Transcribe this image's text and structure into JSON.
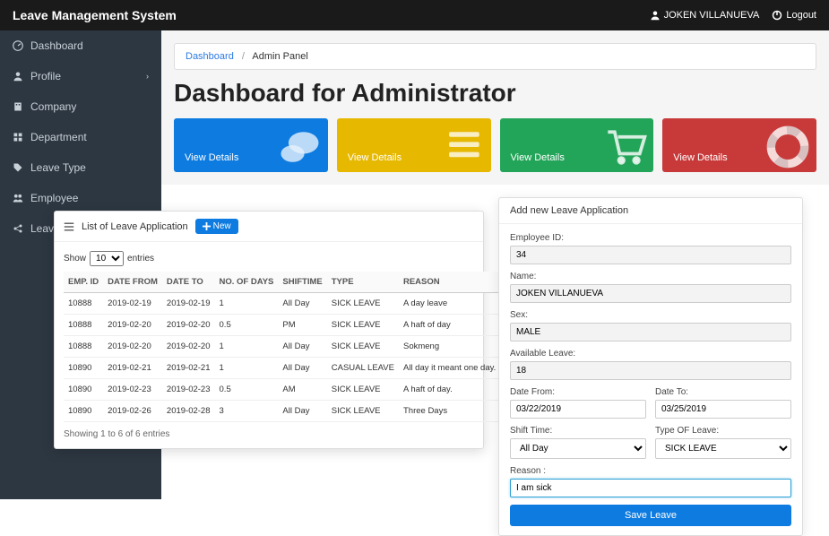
{
  "app_title": "Leave Management System",
  "user_name": "JOKEN VILLANUEVA",
  "logout_label": "Logout",
  "sidebar": {
    "items": [
      {
        "label": "Dashboard",
        "icon": "dashboard"
      },
      {
        "label": "Profile",
        "icon": "user",
        "expandable": true
      },
      {
        "label": "Company",
        "icon": "building"
      },
      {
        "label": "Department",
        "icon": "grid"
      },
      {
        "label": "Leave Type",
        "icon": "tag"
      },
      {
        "label": "Employee",
        "icon": "users"
      },
      {
        "label": "Leav",
        "icon": "share"
      }
    ]
  },
  "breadcrumb": {
    "root": "Dashboard",
    "current": "Admin Panel"
  },
  "page_heading": "Dashboard for Administrator",
  "cards": [
    {
      "color": "blue",
      "label": "View Details",
      "icon": "chat"
    },
    {
      "color": "yellow",
      "label": "View Details",
      "icon": "list"
    },
    {
      "color": "green",
      "label": "View Details",
      "icon": "cart"
    },
    {
      "color": "red",
      "label": "View Details",
      "icon": "lifesaver"
    }
  ],
  "table_panel": {
    "title": "List of Leave Application",
    "new_label": "New",
    "show_label": "Show",
    "entries_label": "entries",
    "page_len": "10",
    "columns": [
      "EMP. ID",
      "DATE FROM",
      "DATE TO",
      "NO. OF DAYS",
      "SHIFTIME",
      "TYPE",
      "REASON"
    ],
    "rows": [
      [
        "10888",
        "2019-02-19",
        "2019-02-19",
        "1",
        "All Day",
        "SICK LEAVE",
        "A day leave"
      ],
      [
        "10888",
        "2019-02-20",
        "2019-02-20",
        "0.5",
        "PM",
        "SICK LEAVE",
        "A haft of day"
      ],
      [
        "10888",
        "2019-02-20",
        "2019-02-20",
        "1",
        "All Day",
        "SICK LEAVE",
        "Sokmeng"
      ],
      [
        "10890",
        "2019-02-21",
        "2019-02-21",
        "1",
        "All Day",
        "CASUAL LEAVE",
        "All day it meant one day."
      ],
      [
        "10890",
        "2019-02-23",
        "2019-02-23",
        "0.5",
        "AM",
        "SICK LEAVE",
        "A haft of day."
      ],
      [
        "10890",
        "2019-02-26",
        "2019-02-28",
        "3",
        "All Day",
        "SICK LEAVE",
        "Three Days"
      ]
    ],
    "info": "Showing 1 to 6 of 6 entries"
  },
  "form": {
    "title": "Add new Leave Application",
    "emp_id_label": "Employee ID:",
    "emp_id": "34",
    "name_label": "Name:",
    "name": "JOKEN VILLANUEVA",
    "sex_label": "Sex:",
    "sex": "MALE",
    "avail_label": "Available Leave:",
    "avail": "18",
    "date_from_label": "Date From:",
    "date_from": "03/22/2019",
    "date_to_label": "Date To:",
    "date_to": "03/25/2019",
    "shift_label": "Shift Time:",
    "shift": "All Day",
    "type_label": "Type OF Leave:",
    "type": "SICK LEAVE",
    "reason_label": "Reason :",
    "reason": "I am sick",
    "save_label": "Save Leave"
  }
}
